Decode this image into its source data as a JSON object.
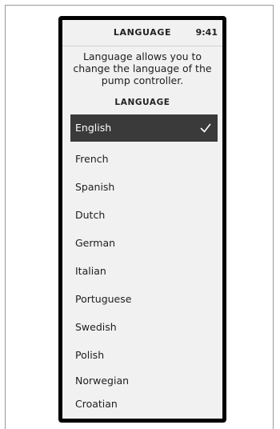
{
  "header": {
    "title": "LANGUAGE",
    "time": "9:41"
  },
  "description": "Language allows you to change the language of the pump controller.",
  "section_heading": "LANGUAGE",
  "languages": {
    "selected": "English",
    "items": [
      {
        "label": "English",
        "selected": true
      },
      {
        "label": "French"
      },
      {
        "label": "Spanish"
      },
      {
        "label": "Dutch"
      },
      {
        "label": "German"
      },
      {
        "label": "Italian"
      },
      {
        "label": "Portuguese"
      },
      {
        "label": "Swedish"
      },
      {
        "label": "Polish"
      },
      {
        "label": "Norwegian"
      },
      {
        "label": "Croatian"
      }
    ]
  },
  "colors": {
    "selected_bg": "#3a3a3a",
    "screen_bg": "#f1f1f1",
    "frame": "#000000"
  },
  "icons": {
    "selected_marker": "checkmark-icon"
  }
}
